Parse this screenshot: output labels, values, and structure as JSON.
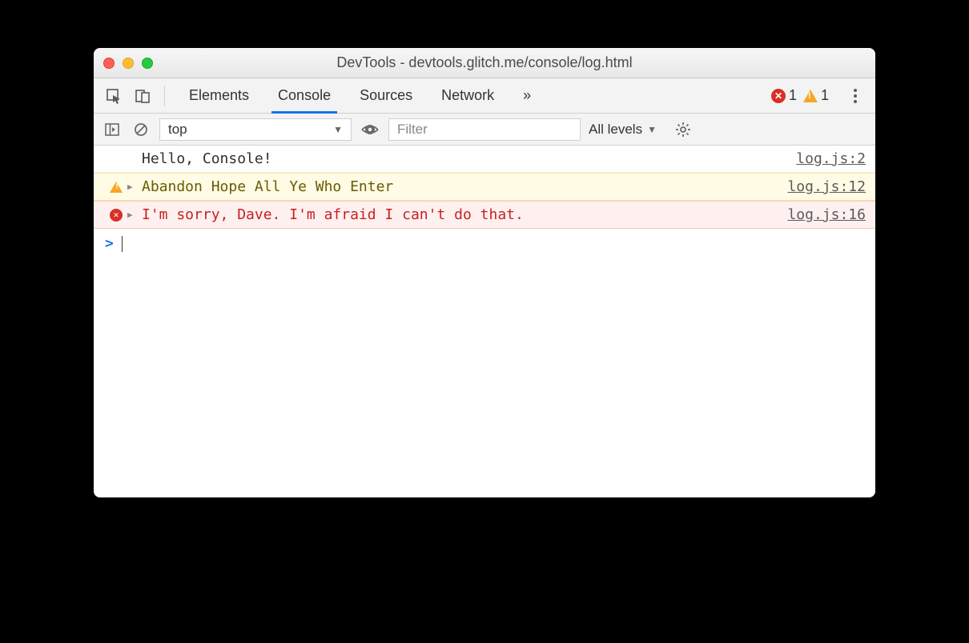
{
  "window": {
    "title": "DevTools - devtools.glitch.me/console/log.html"
  },
  "tabs": {
    "elements": "Elements",
    "console": "Console",
    "sources": "Sources",
    "network": "Network",
    "overflow": "»"
  },
  "counts": {
    "errors": "1",
    "warnings": "1"
  },
  "toolbar": {
    "context": "top",
    "filter_placeholder": "Filter",
    "levels_label": "All levels"
  },
  "messages": [
    {
      "type": "log",
      "text": "Hello, Console!",
      "source": "log.js:2"
    },
    {
      "type": "warn",
      "text": "Abandon Hope All Ye Who Enter",
      "source": "log.js:12"
    },
    {
      "type": "error",
      "text": "I'm sorry, Dave. I'm afraid I can't do that.",
      "source": "log.js:16"
    }
  ]
}
